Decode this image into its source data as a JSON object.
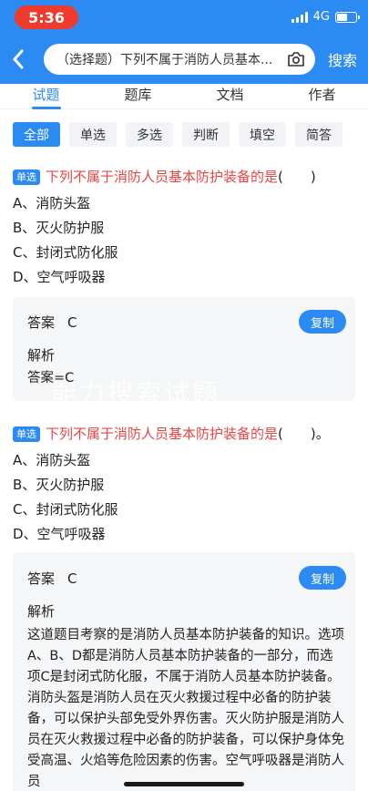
{
  "status_bar": {
    "time": "5:36",
    "network": "4G"
  },
  "search": {
    "query": "（选择题）下列不属于消防人员基本...",
    "button_label": "搜索"
  },
  "tabs": [
    {
      "label": "试题",
      "active": true
    },
    {
      "label": "题库",
      "active": false
    },
    {
      "label": "文档",
      "active": false
    },
    {
      "label": "作者",
      "active": false
    }
  ],
  "filters": [
    {
      "label": "全部",
      "active": true
    },
    {
      "label": "单选",
      "active": false
    },
    {
      "label": "多选",
      "active": false
    },
    {
      "label": "判断",
      "active": false
    },
    {
      "label": "填空",
      "active": false
    },
    {
      "label": "简答",
      "active": false
    }
  ],
  "questions": [
    {
      "badge": "单选",
      "stem": "下列不属于消防人员基本防护装备的是",
      "tail": "(　　)",
      "options": [
        "A、消防头盔",
        "B、灭火防护服",
        "C、封闭式防化服",
        "D、空气呼吸器"
      ],
      "answer_label": "答案",
      "answer_value": "C",
      "copy_label": "复制",
      "analysis_label": "解析",
      "analysis_text": "答案=C"
    },
    {
      "badge": "单选",
      "stem": "下列不属于消防人员基本防护装备的是",
      "tail": "(　　)。",
      "options": [
        "A、消防头盔",
        "B、灭火防护服",
        "C、封闭式防化服",
        "D、空气呼吸器"
      ],
      "answer_label": "答案",
      "answer_value": "C",
      "copy_label": "复制",
      "analysis_label": "解析",
      "analysis_text": "这道题目考察的是消防人员基本防护装备的知识。选项A、B、D都是消防人员基本防护装备的一部分，而选项C是封闭式防化服，不属于消防人员基本防护装备。消防头盔是消防人员在灭火救援过程中必备的防护装备，可以保护头部免受外界伤害。灭火防护服是消防人员在灭火救援过程中必备的防护装备，可以保护身体免受高温、火焰等危险因素的伤害。空气呼吸器是消防人员"
    }
  ],
  "watermark": "能力搜索试题",
  "colors": {
    "primary": "#2b8bf2",
    "stem": "#e84545",
    "time_pill": "#ef3b2d",
    "card_bg": "#f5f6f8"
  }
}
